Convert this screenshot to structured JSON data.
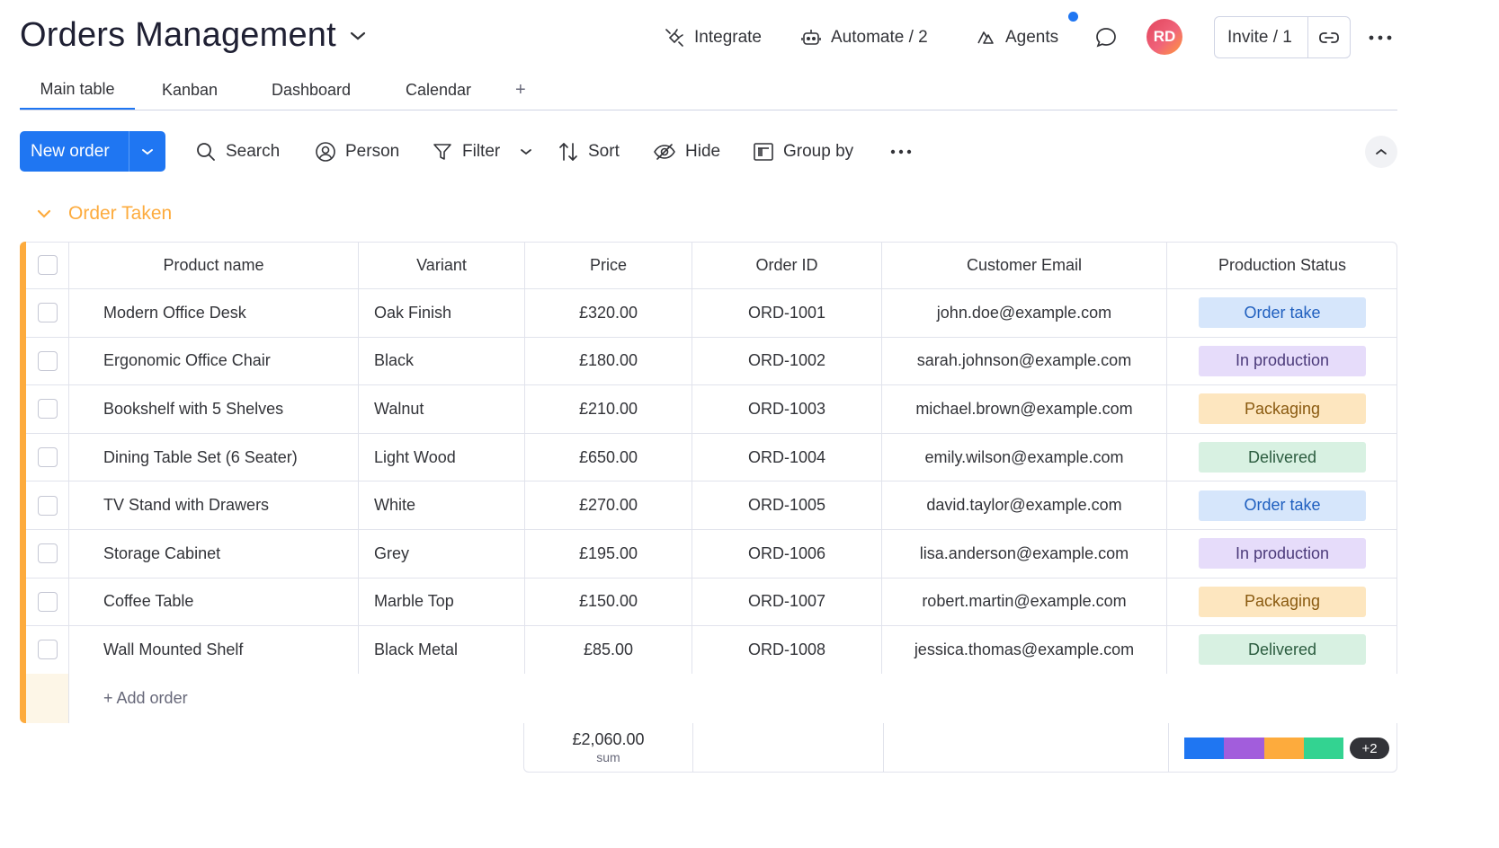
{
  "board": {
    "title": "Orders Management"
  },
  "header": {
    "integrate": "Integrate",
    "automate": "Automate / 2",
    "agents": "Agents",
    "avatar_initials": "RD",
    "invite": "Invite / 1"
  },
  "tabs": [
    {
      "label": "Main table",
      "active": true
    },
    {
      "label": "Kanban"
    },
    {
      "label": "Dashboard"
    },
    {
      "label": "Calendar"
    }
  ],
  "toolbar": {
    "new_item": "New order",
    "search": "Search",
    "person": "Person",
    "filter": "Filter",
    "sort": "Sort",
    "hide": "Hide",
    "group_by": "Group by"
  },
  "group": {
    "title": "Order Taken",
    "color": "#fdab3d",
    "columns": [
      "Product name",
      "Variant",
      "Price",
      "Order ID",
      "Customer Email",
      "Production Status"
    ],
    "rows": [
      {
        "product": "Modern Office Desk",
        "variant": "Oak Finish",
        "price": "£320.00",
        "order_id": "ORD-1001",
        "email": "john.doe@example.com",
        "status": "Order take"
      },
      {
        "product": "Ergonomic Office Chair",
        "variant": "Black",
        "price": "£180.00",
        "order_id": "ORD-1002",
        "email": "sarah.johnson@example.com",
        "status": "In production"
      },
      {
        "product": "Bookshelf with 5 Shelves",
        "variant": "Walnut",
        "price": "£210.00",
        "order_id": "ORD-1003",
        "email": "michael.brown@example.com",
        "status": "Packaging"
      },
      {
        "product": "Dining Table Set (6 Seater)",
        "variant": "Light Wood",
        "price": "£650.00",
        "order_id": "ORD-1004",
        "email": "emily.wilson@example.com",
        "status": "Delivered"
      },
      {
        "product": "TV Stand with Drawers",
        "variant": "White",
        "price": "£270.00",
        "order_id": "ORD-1005",
        "email": "david.taylor@example.com",
        "status": "Order take"
      },
      {
        "product": "Storage Cabinet",
        "variant": "Grey",
        "price": "£195.00",
        "order_id": "ORD-1006",
        "email": "lisa.anderson@example.com",
        "status": "In production"
      },
      {
        "product": "Coffee Table",
        "variant": "Marble Top",
        "price": "£150.00",
        "order_id": "ORD-1007",
        "email": "robert.martin@example.com",
        "status": "Packaging"
      },
      {
        "product": "Wall Mounted Shelf",
        "variant": "Black Metal",
        "price": "£85.00",
        "order_id": "ORD-1008",
        "email": "jessica.thomas@example.com",
        "status": "Delivered"
      }
    ],
    "add_item": "+ Add order"
  },
  "status_colors": {
    "Order take": {
      "bg": "#d6e6fb",
      "fg": "#1f5fbf"
    },
    "In production": {
      "bg": "#e6dcfa",
      "fg": "#4b3a7a"
    },
    "Packaging": {
      "bg": "#fde6bf",
      "fg": "#8a5a10"
    },
    "Delivered": {
      "bg": "#d8f1e2",
      "fg": "#2b5c3f"
    }
  },
  "summary": {
    "price_sum": "£2,060.00",
    "price_sum_label": "sum",
    "status_distribution": [
      {
        "color": "#1f76f2",
        "share": 0.25
      },
      {
        "color": "#a25ddc",
        "share": 0.25
      },
      {
        "color": "#fdab3d",
        "share": 0.25
      },
      {
        "color": "#33d391",
        "share": 0.25
      }
    ],
    "more_badge": "+2"
  }
}
